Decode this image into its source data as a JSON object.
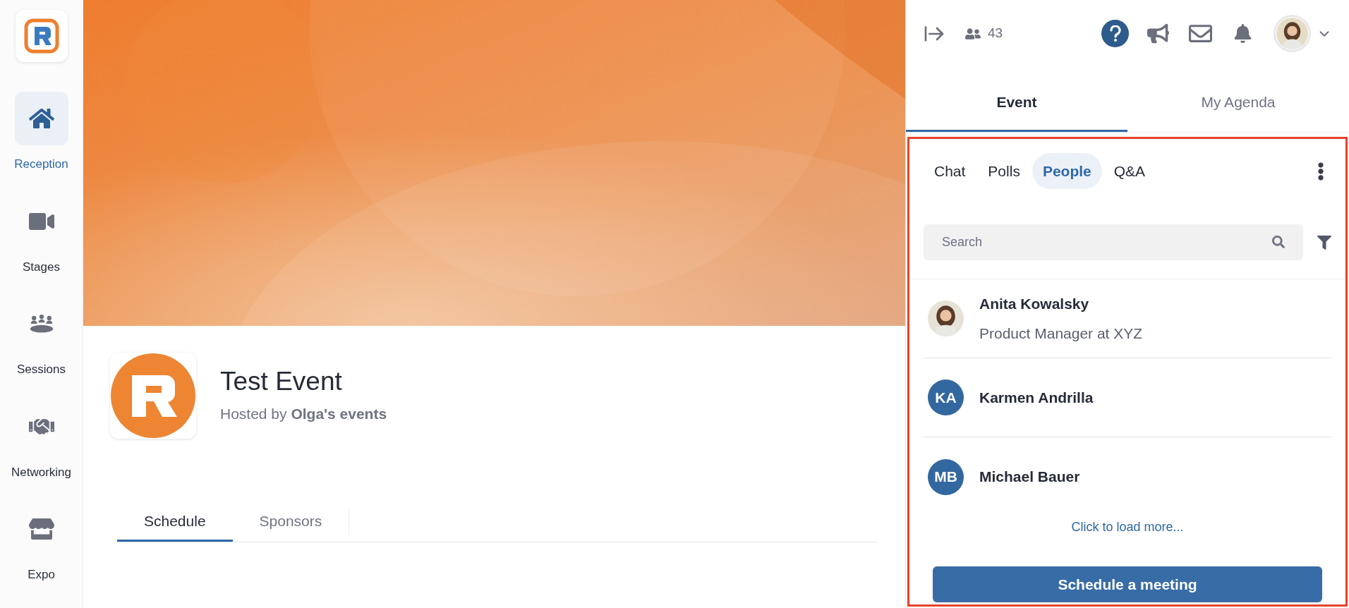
{
  "sidebar": {
    "items": [
      {
        "label": "Reception",
        "selected": true
      },
      {
        "label": "Stages",
        "selected": false
      },
      {
        "label": "Sessions",
        "selected": false
      },
      {
        "label": "Networking",
        "selected": false
      },
      {
        "label": "Expo",
        "selected": false
      }
    ]
  },
  "event": {
    "title": "Test Event",
    "host_line": "Hosted by **Olga's events**",
    "tabs": [
      {
        "label": "Schedule",
        "selected": true
      },
      {
        "label": "Sponsors",
        "selected": false
      }
    ]
  },
  "top_bar": {
    "attendee_count": "43"
  },
  "panel_tabs": [
    {
      "label": "Event",
      "selected": true
    },
    {
      "label": "My Agenda",
      "selected": false
    }
  ],
  "sub_tabs": [
    {
      "label": "Chat",
      "selected": false
    },
    {
      "label": "Polls",
      "selected": false
    },
    {
      "label": "People",
      "selected": true
    },
    {
      "label": "Q&A",
      "selected": false
    }
  ],
  "search": {
    "placeholder": "Search"
  },
  "people": [
    {
      "name": "Anita Kowalsky",
      "title": "Product Manager at XYZ"
    },
    {
      "kind": "initials",
      "initials": "KA",
      "name": "Karmen Andrilla"
    },
    {
      "kind": "initials",
      "initials": "MB",
      "name": "Michael Bauer"
    }
  ],
  "load_more": "Click to load more...",
  "action_button": "Schedule a meeting"
}
